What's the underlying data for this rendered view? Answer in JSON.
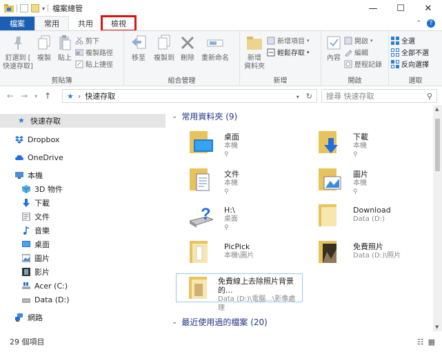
{
  "window": {
    "title": "檔案總管"
  },
  "window_buttons": {
    "minimize": "—",
    "maximize": "☐",
    "close": "✕"
  },
  "tabs": [
    {
      "label": "檔案"
    },
    {
      "label": "常用"
    },
    {
      "label": "共用"
    },
    {
      "label": "檢視"
    }
  ],
  "ribbon": {
    "clipboard": {
      "pin": "釘選到 [",
      "pin2": "快速存取]",
      "copy": "複製",
      "paste": "貼上",
      "cut": "剪下",
      "copy_path": "複製路徑",
      "paste_shortcut": "貼上捷徑",
      "label": "剪貼簿"
    },
    "organize": {
      "move": "移至",
      "copy_to": "複製到",
      "delete": "刪除",
      "rename": "重新命名",
      "label": "組合管理"
    },
    "new": {
      "new_folder": "新增",
      "new_folder2": "資料夾",
      "new_item": "新增項目",
      "easy_access": "輕鬆存取",
      "label": "新增"
    },
    "open": {
      "properties": "內容",
      "open": "開啟",
      "edit": "編輯",
      "history": "歷程記錄",
      "label": "開啟"
    },
    "select": {
      "select_all": "全選",
      "select_none": "全部不選",
      "invert": "反向選擇",
      "label": "選取"
    }
  },
  "address": {
    "path": "快速存取",
    "search_placeholder": "搜尋 快速存取"
  },
  "sidebar": {
    "items": [
      {
        "label": "快速存取"
      },
      {
        "label": "Dropbox"
      },
      {
        "label": "OneDrive"
      },
      {
        "label": "本機"
      },
      {
        "label": "3D 物件"
      },
      {
        "label": "下載"
      },
      {
        "label": "文件"
      },
      {
        "label": "音樂"
      },
      {
        "label": "桌面"
      },
      {
        "label": "圖片"
      },
      {
        "label": "影片"
      },
      {
        "label": "Acer (C:)"
      },
      {
        "label": "Data (D:)"
      },
      {
        "label": "網路"
      }
    ]
  },
  "main": {
    "frequent_header": "常用資料夾 (9)",
    "recent_header": "最近使用過的檔案 (20)",
    "tiles": [
      {
        "name": "桌面",
        "sub": "本機"
      },
      {
        "name": "下載",
        "sub": "本機"
      },
      {
        "name": "文件",
        "sub": "本機"
      },
      {
        "name": "圖片",
        "sub": "本機"
      },
      {
        "name": "H:\\",
        "sub": "桌面"
      },
      {
        "name": "Download",
        "sub": "Data (D:)"
      },
      {
        "name": "PicPick",
        "sub": "本機\\圖片"
      },
      {
        "name": "免費照片",
        "sub": "Data (D:)\\照片"
      },
      {
        "name": "免費線上去除照片背景的...",
        "sub": "Data (D:)\\電腦...\\影像處理"
      }
    ]
  },
  "status": {
    "count": "29 個項目"
  },
  "colors": {
    "file_tab": "#1a5fb4",
    "highlight_box": "#e01010",
    "folder": "#e8c25a",
    "accent": "#1e3287"
  }
}
